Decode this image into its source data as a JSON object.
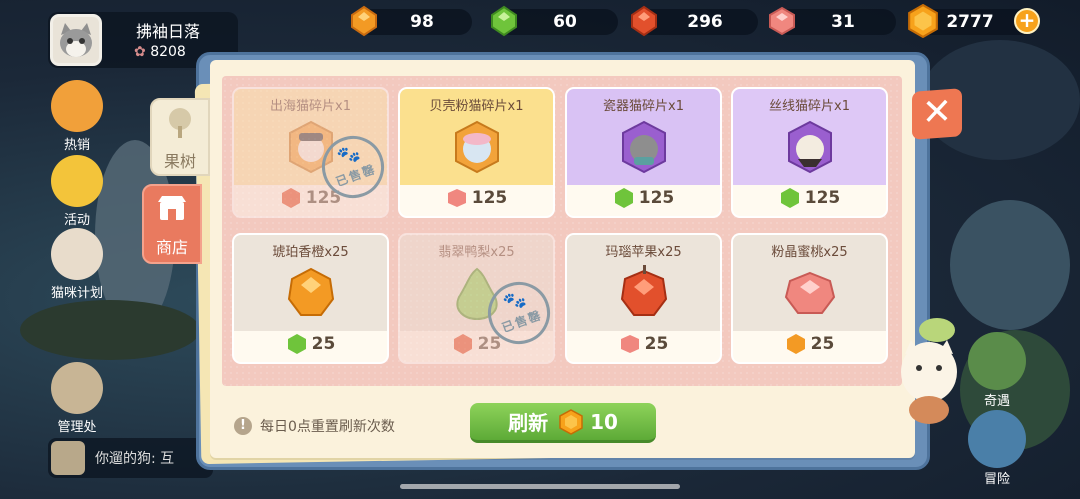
{
  "player": {
    "name": "拂袖日落",
    "score": "8208"
  },
  "resources": [
    {
      "id": "amber",
      "value": "98",
      "color": "#f39a24"
    },
    {
      "id": "green",
      "value": "60",
      "color": "#6fc43b"
    },
    {
      "id": "red",
      "value": "296",
      "color": "#e2502c"
    },
    {
      "id": "pink",
      "value": "31",
      "color": "#f0877f"
    },
    {
      "id": "coin",
      "value": "2777",
      "color": "#f7a21b"
    }
  ],
  "left_menu": [
    "热销",
    "活动",
    "猫咪计划",
    "管理处"
  ],
  "tabs": {
    "fruit": "果树",
    "shop": "商店"
  },
  "cards": [
    {
      "title": "出海猫碎片x1",
      "price": "125",
      "currency": "red",
      "sold": true,
      "bg": "#fbe4a8"
    },
    {
      "title": "贝壳粉猫碎片x1",
      "price": "125",
      "currency": "pink",
      "sold": false,
      "bg": "#fbe08e"
    },
    {
      "title": "瓷器猫碎片x1",
      "price": "125",
      "currency": "green",
      "sold": false,
      "bg": "#d9c2f4"
    },
    {
      "title": "丝线猫碎片x1",
      "price": "125",
      "currency": "green",
      "sold": false,
      "bg": "#dec8f6"
    },
    {
      "title": "琥珀香橙x25",
      "price": "25",
      "currency": "green",
      "sold": false,
      "bg": "#ece4da"
    },
    {
      "title": "翡翠鸭梨x25",
      "price": "25",
      "currency": "red",
      "sold": true,
      "bg": "#ece4da"
    },
    {
      "title": "玛瑙苹果x25",
      "price": "25",
      "currency": "pink",
      "sold": false,
      "bg": "#ece4da"
    },
    {
      "title": "粉晶蜜桃x25",
      "price": "25",
      "currency": "amber",
      "sold": false,
      "bg": "#ece4da"
    }
  ],
  "sold_stamp": "已售罄",
  "footer": {
    "tip": "每日0点重置刷新次数",
    "refresh_label": "刷新",
    "refresh_cost": "10"
  },
  "right_menu": [
    "奇遇",
    "冒险"
  ],
  "chat": {
    "text": "你遛的狗: 互"
  }
}
